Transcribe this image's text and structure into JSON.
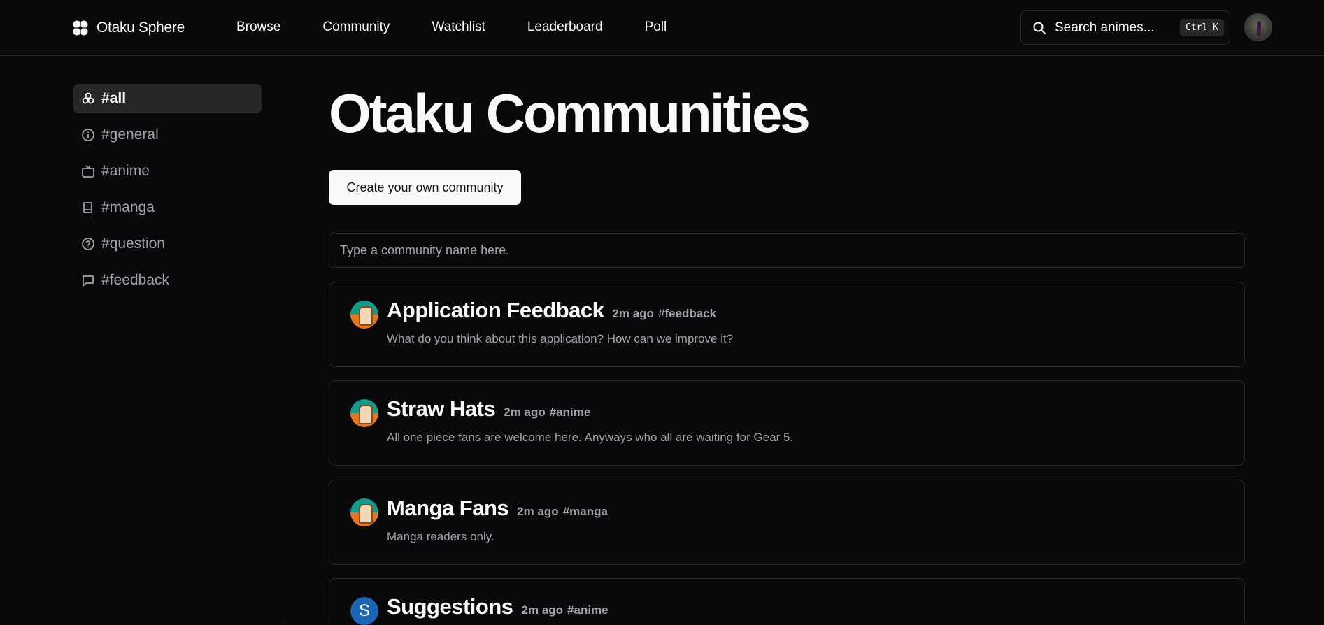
{
  "app": {
    "name": "Otaku Sphere"
  },
  "nav": {
    "items": [
      {
        "label": "Browse"
      },
      {
        "label": "Community"
      },
      {
        "label": "Watchlist"
      },
      {
        "label": "Leaderboard"
      },
      {
        "label": "Poll"
      }
    ]
  },
  "search": {
    "label": "Search animes...",
    "shortcut": "Ctrl K"
  },
  "sidebar": {
    "items": [
      {
        "label": "#all",
        "icon": "network-icon",
        "active": true
      },
      {
        "label": "#general",
        "icon": "info-icon"
      },
      {
        "label": "#anime",
        "icon": "tv-icon"
      },
      {
        "label": "#manga",
        "icon": "book-icon"
      },
      {
        "label": "#question",
        "icon": "help-circle-icon"
      },
      {
        "label": "#feedback",
        "icon": "message-square-icon"
      }
    ]
  },
  "main": {
    "title": "Otaku Communities",
    "create_label": "Create your own community",
    "input_placeholder": "Type a community name here.",
    "communities": [
      {
        "title": "Application Feedback",
        "time": "2m ago",
        "tag": "#feedback",
        "description": "What do you think about this application? How can we improve it?",
        "avatar": "character"
      },
      {
        "title": "Straw Hats",
        "time": "2m ago",
        "tag": "#anime",
        "description": "All one piece fans are welcome here. Anyways who all are waiting for Gear 5.",
        "avatar": "character"
      },
      {
        "title": "Manga Fans",
        "time": "2m ago",
        "tag": "#manga",
        "description": "Manga readers only.",
        "avatar": "character"
      },
      {
        "title": "Suggestions",
        "time": "2m ago",
        "tag": "#anime",
        "description": "",
        "avatar": "S"
      }
    ]
  },
  "colors": {
    "background": "#09090b",
    "border": "#27272a",
    "muted": "#a1a1aa",
    "foreground": "#fafafa"
  }
}
